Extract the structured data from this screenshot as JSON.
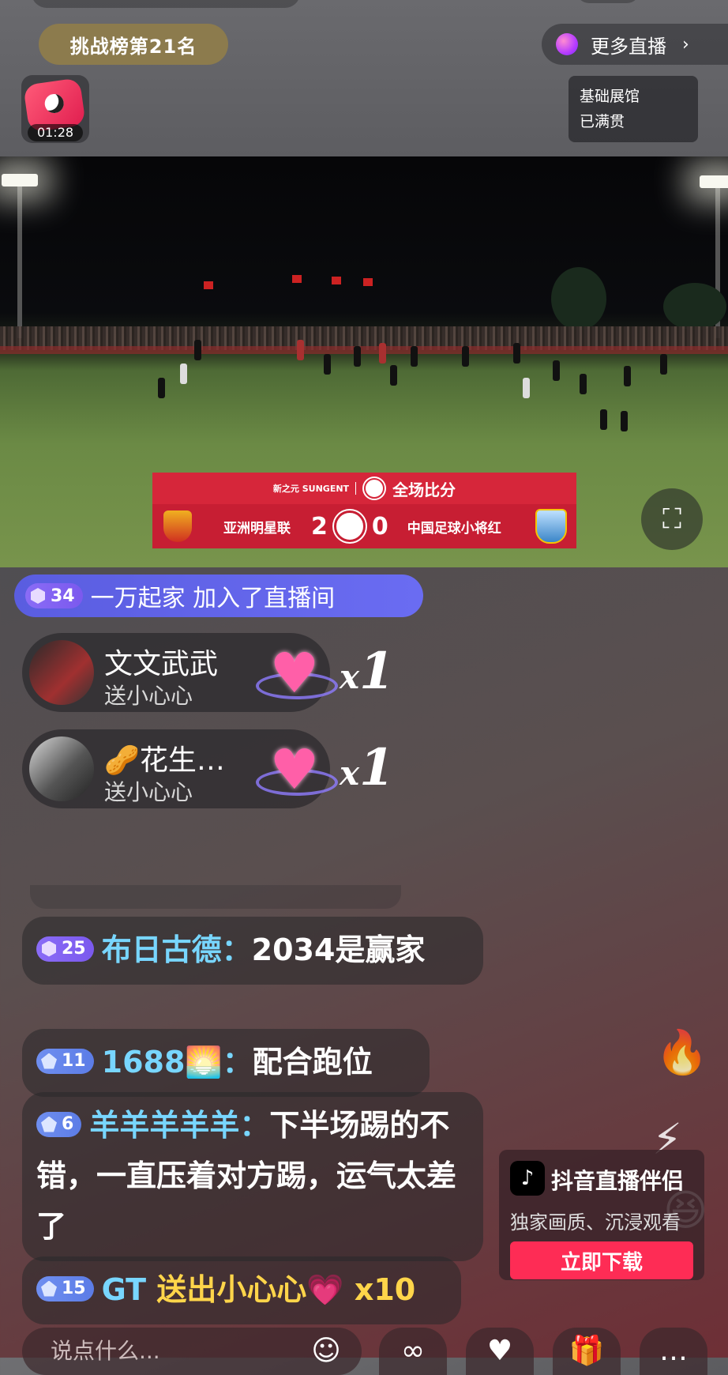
{
  "header": {
    "rank_label": "挑战榜第21名",
    "more_live_label": "更多直播",
    "more_live_chevron": "›",
    "gift_timer": "01:28",
    "badge_line1": "基础展馆",
    "badge_line2": "已满贯"
  },
  "scoreboard": {
    "sponsor": "新之元 SUNGENT",
    "title": "全场比分",
    "home_team": "亚洲明星联",
    "home_score": "2",
    "away_score": "0",
    "away_team": "中国足球小将红"
  },
  "join_notice": {
    "level": "34",
    "text": "一万起家 加入了直播间"
  },
  "gifts": [
    {
      "name": "文文武武",
      "action": "送小心心",
      "x": "x",
      "count": "1"
    },
    {
      "name": "🥜花生…",
      "action": "送小心心",
      "x": "x",
      "count": "1"
    }
  ],
  "messages": [
    {
      "level": "25",
      "user": "布日古德：",
      "text": "2034是赢家"
    },
    {
      "level": "11",
      "user": "1688🌅：",
      "text": "配合跑位"
    },
    {
      "level": "6",
      "user": "羊羊羊羊羊：",
      "text": "下半场踢的不错，一直压着对方踢，运气太差了"
    },
    {
      "level": "15",
      "user": "GT",
      "text": "送出小心心💗 x10"
    }
  ],
  "ad": {
    "title": "抖音直播伴侣",
    "desc": "独家画质、沉浸观看",
    "button": "立即下载"
  },
  "bottom": {
    "comment_placeholder": "说点什么..."
  },
  "colors": {
    "accent_red": "#fe2c55",
    "username_blue": "#78d6ff",
    "gift_gold": "#ffd54a",
    "join_purple": "#5a5de0"
  }
}
